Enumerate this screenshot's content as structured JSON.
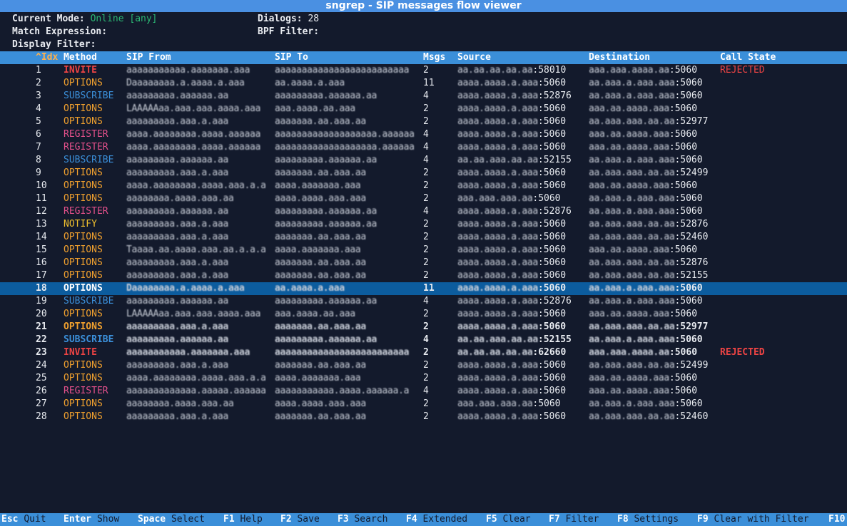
{
  "title": "sngrep - SIP messages flow viewer",
  "info": {
    "mode_label": "Current Mode:",
    "mode_value": "Online [any]",
    "dialogs_label": "Dialogs:",
    "dialogs_value": "28",
    "match_label": "Match Expression:",
    "bpf_label": "BPF Filter:",
    "display_label": "Display Filter:"
  },
  "columns": [
    "^Idx",
    "Method",
    "SIP From",
    "SIP To",
    "Msgs",
    "Source",
    "Destination",
    "Call State"
  ],
  "rows": [
    {
      "check": "[ ]",
      "idx": "1",
      "method": "INVITE",
      "from": "aaaaaaaaaaa.aaaaaaa.aaa",
      "to": "aaaaaaaaaaaaaaaaaaaaaaaaa",
      "msgs": "2",
      "src_ip": "aa.aa.aa.aa.aa",
      "src_port": ":58010",
      "dst_ip": "aaa.aaa.aaaa.aa",
      "dst_port": ":5060",
      "state": "REJECTED"
    },
    {
      "check": "[ ]",
      "idx": "2",
      "method": "OPTIONS",
      "from": "Daaaaaaaa.a.aaaa.a.aaa",
      "to": "aa.aaaa.a.aaa",
      "msgs": "11",
      "src_ip": "aaaa.aaaa.a.aaa",
      "src_port": ":5060",
      "dst_ip": "aa.aaa.a.aaa.aaa",
      "dst_port": ":5060",
      "state": ""
    },
    {
      "check": "[ ]",
      "idx": "3",
      "method": "SUBSCRIBE",
      "from": "aaaaaaaaa.aaaaaa.aa",
      "to": "aaaaaaaaa.aaaaaa.aa",
      "msgs": "4",
      "src_ip": "aaaa.aaaa.a.aaa",
      "src_port": ":52876",
      "dst_ip": "aa.aaa.a.aaa.aaa",
      "dst_port": ":5060",
      "state": ""
    },
    {
      "check": "[ ]",
      "idx": "4",
      "method": "OPTIONS",
      "from": "LAAAAAaa.aaa.aaa.aaaa.aaa",
      "to": "aaa.aaaa.aa.aaa",
      "msgs": "2",
      "src_ip": "aaaa.aaaa.a.aaa",
      "src_port": ":5060",
      "dst_ip": "aaa.aa.aaaa.aaa",
      "dst_port": ":5060",
      "state": ""
    },
    {
      "check": "[ ]",
      "idx": "5",
      "method": "OPTIONS",
      "from": "aaaaaaaaa.aaa.a.aaa",
      "to": "aaaaaaa.aa.aaa.aa",
      "msgs": "2",
      "src_ip": "aaaa.aaaa.a.aaa",
      "src_port": ":5060",
      "dst_ip": "aa.aaa.aaa.aa.aa",
      "dst_port": ":52977",
      "state": ""
    },
    {
      "check": "[ ]",
      "idx": "6",
      "method": "REGISTER",
      "from": "aaaa.aaaaaaaa.aaaa.aaaaaa",
      "to": "aaaaaaaaaaaaaaaaaaa.aaaaaa",
      "msgs": "4",
      "src_ip": "aaaa.aaaa.a.aaa",
      "src_port": ":5060",
      "dst_ip": "aaa.aa.aaaa.aaa",
      "dst_port": ":5060",
      "state": ""
    },
    {
      "check": "[ ]",
      "idx": "7",
      "method": "REGISTER",
      "from": "aaaa.aaaaaaaa.aaaa.aaaaaa",
      "to": "aaaaaaaaaaaaaaaaaaa.aaaaaa",
      "msgs": "4",
      "src_ip": "aaaa.aaaa.a.aaa",
      "src_port": ":5060",
      "dst_ip": "aaa.aa.aaaa.aaa",
      "dst_port": ":5060",
      "state": ""
    },
    {
      "check": "[ ]",
      "idx": "8",
      "method": "SUBSCRIBE",
      "from": "aaaaaaaaa.aaaaaa.aa",
      "to": "aaaaaaaaa.aaaaaa.aa",
      "msgs": "4",
      "src_ip": "aa.aa.aaa.aa.aa",
      "src_port": ":52155",
      "dst_ip": "aa.aaa.a.aaa.aaa",
      "dst_port": ":5060",
      "state": ""
    },
    {
      "check": "[ ]",
      "idx": "9",
      "method": "OPTIONS",
      "from": "aaaaaaaaa.aaa.a.aaa",
      "to": "aaaaaaa.aa.aaa.aa",
      "msgs": "2",
      "src_ip": "aaaa.aaaa.a.aaa",
      "src_port": ":5060",
      "dst_ip": "aa.aaa.aaa.aa.aa",
      "dst_port": ":52499",
      "state": ""
    },
    {
      "check": "[ ]",
      "idx": "10",
      "method": "OPTIONS",
      "from": "aaaa.aaaaaaaa.aaaa.aaa.a.a",
      "to": "aaaa.aaaaaaa.aaa",
      "msgs": "2",
      "src_ip": "aaaa.aaaa.a.aaa",
      "src_port": ":5060",
      "dst_ip": "aaa.aa.aaaa.aaa",
      "dst_port": ":5060",
      "state": ""
    },
    {
      "check": "[ ]",
      "idx": "11",
      "method": "OPTIONS",
      "from": "aaaaaaaa.aaaa.aaa.aa",
      "to": "aaaa.aaaa.aaa.aaa",
      "msgs": "2",
      "src_ip": "aaa.aaa.aaa.aa",
      "src_port": ":5060",
      "dst_ip": "aa.aaa.a.aaa.aaa",
      "dst_port": ":5060",
      "state": ""
    },
    {
      "check": "[ ]",
      "idx": "12",
      "method": "REGISTER",
      "from": "aaaaaaaaa.aaaaaa.aa",
      "to": "aaaaaaaaa.aaaaaa.aa",
      "msgs": "4",
      "src_ip": "aaaa.aaaa.a.aaa",
      "src_port": ":52876",
      "dst_ip": "aa.aaa.a.aaa.aaa",
      "dst_port": ":5060",
      "state": ""
    },
    {
      "check": "[ ]",
      "idx": "13",
      "method": "NOTIFY",
      "from": "aaaaaaaaa.aaa.a.aaa",
      "to": "aaaaaaaaa.aaaaaa.aa",
      "msgs": "2",
      "src_ip": "aaaa.aaaa.a.aaa",
      "src_port": ":5060",
      "dst_ip": "aa.aaa.aaa.aa.aa",
      "dst_port": ":52876",
      "state": ""
    },
    {
      "check": "[ ]",
      "idx": "14",
      "method": "OPTIONS",
      "from": "aaaaaaaaa.aaa.a.aaa",
      "to": "aaaaaaa.aa.aaa.aa",
      "msgs": "2",
      "src_ip": "aaaa.aaaa.a.aaa",
      "src_port": ":5060",
      "dst_ip": "aa.aaa.aaa.aa.aa",
      "dst_port": ":52460",
      "state": ""
    },
    {
      "check": "[ ]",
      "idx": "15",
      "method": "OPTIONS",
      "from": "Taaaa.aa.aaaa.aaa.aa.a.a.a",
      "to": "aaaa.aaaaaaa.aaa",
      "msgs": "2",
      "src_ip": "aaaa.aaaa.a.aaa",
      "src_port": ":5060",
      "dst_ip": "aaa.aa.aaaa.aaa",
      "dst_port": ":5060",
      "state": ""
    },
    {
      "check": "[ ]",
      "idx": "16",
      "method": "OPTIONS",
      "from": "aaaaaaaaa.aaa.a.aaa",
      "to": "aaaaaaa.aa.aaa.aa",
      "msgs": "2",
      "src_ip": "aaaa.aaaa.a.aaa",
      "src_port": ":5060",
      "dst_ip": "aa.aaa.aaa.aa.aa",
      "dst_port": ":52876",
      "state": ""
    },
    {
      "check": "[ ]",
      "idx": "17",
      "method": "OPTIONS",
      "from": "aaaaaaaaa.aaa.a.aaa",
      "to": "aaaaaaa.aa.aaa.aa",
      "msgs": "2",
      "src_ip": "aaaa.aaaa.a.aaa",
      "src_port": ":5060",
      "dst_ip": "aa.aaa.aaa.aa.aa",
      "dst_port": ":52155",
      "state": ""
    },
    {
      "check": "[*]",
      "idx": "18",
      "method": "OPTIONS",
      "from": "Daaaaaaaa.a.aaaa.a.aaa",
      "to": "aa.aaaa.a.aaa",
      "msgs": "11",
      "src_ip": "aaaa.aaaa.a.aaa",
      "src_port": ":5060",
      "dst_ip": "aa.aaa.a.aaa.aaa",
      "dst_port": ":5060",
      "state": "",
      "highlight": true
    },
    {
      "check": "[ ]",
      "idx": "19",
      "method": "SUBSCRIBE",
      "from": "aaaaaaaaa.aaaaaa.aa",
      "to": "aaaaaaaaa.aaaaaa.aa",
      "msgs": "4",
      "src_ip": "aaaa.aaaa.a.aaa",
      "src_port": ":52876",
      "dst_ip": "aa.aaa.a.aaa.aaa",
      "dst_port": ":5060",
      "state": ""
    },
    {
      "check": "[ ]",
      "idx": "20",
      "method": "OPTIONS",
      "from": "LAAAAAaa.aaa.aaa.aaaa.aaa",
      "to": "aaa.aaaa.aa.aaa",
      "msgs": "2",
      "src_ip": "aaaa.aaaa.a.aaa",
      "src_port": ":5060",
      "dst_ip": "aaa.aa.aaaa.aaa",
      "dst_port": ":5060",
      "state": ""
    },
    {
      "check": "[*]",
      "idx": "21",
      "method": "OPTIONS",
      "from": "aaaaaaaaa.aaa.a.aaa",
      "to": "aaaaaaa.aa.aaa.aa",
      "msgs": "2",
      "src_ip": "aaaa.aaaa.a.aaa",
      "src_port": ":5060",
      "dst_ip": "aa.aaa.aaa.aa.aa",
      "dst_port": ":52977",
      "state": "",
      "selected": true
    },
    {
      "check": "[*]",
      "idx": "22",
      "method": "SUBSCRIBE",
      "from": "aaaaaaaaa.aaaaaa.aa",
      "to": "aaaaaaaaa.aaaaaa.aa",
      "msgs": "4",
      "src_ip": "aa.aa.aaa.aa.aa",
      "src_port": ":52155",
      "dst_ip": "aa.aaa.a.aaa.aaa",
      "dst_port": ":5060",
      "state": "",
      "selected": true
    },
    {
      "check": "[*]",
      "idx": "23",
      "method": "INVITE",
      "from": "aaaaaaaaaaa.aaaaaaa.aaa",
      "to": "aaaaaaaaaaaaaaaaaaaaaaaaa",
      "msgs": "2",
      "src_ip": "aa.aa.aa.aa.aa",
      "src_port": ":62660",
      "dst_ip": "aaa.aaa.aaaa.aa",
      "dst_port": ":5060",
      "state": "REJECTED",
      "selected": true
    },
    {
      "check": "[ ]",
      "idx": "24",
      "method": "OPTIONS",
      "from": "aaaaaaaaa.aaa.a.aaa",
      "to": "aaaaaaa.aa.aaa.aa",
      "msgs": "2",
      "src_ip": "aaaa.aaaa.a.aaa",
      "src_port": ":5060",
      "dst_ip": "aa.aaa.aaa.aa.aa",
      "dst_port": ":52499",
      "state": ""
    },
    {
      "check": "[ ]",
      "idx": "25",
      "method": "OPTIONS",
      "from": "aaaa.aaaaaaaa.aaaa.aaa.a.a",
      "to": "aaaa.aaaaaaa.aaa",
      "msgs": "2",
      "src_ip": "aaaa.aaaa.a.aaa",
      "src_port": ":5060",
      "dst_ip": "aaa.aa.aaaa.aaa",
      "dst_port": ":5060",
      "state": ""
    },
    {
      "check": "[ ]",
      "idx": "26",
      "method": "REGISTER",
      "from": "aaaaaaaaaaaaa.aaaaa.aaaaaa",
      "to": "aaaaaaaaaaa.aaaa.aaaaaa.a",
      "msgs": "4",
      "src_ip": "aaaa.aaaa.a.aaa",
      "src_port": ":5060",
      "dst_ip": "aaa.aa.aaaa.aaa",
      "dst_port": ":5060",
      "state": ""
    },
    {
      "check": "[ ]",
      "idx": "27",
      "method": "OPTIONS",
      "from": "aaaaaaaa.aaaa.aaa.aa",
      "to": "aaaa.aaaa.aaa.aaa",
      "msgs": "2",
      "src_ip": "aaa.aaa.aaa.aa",
      "src_port": ":5060",
      "dst_ip": "aa.aaa.a.aaa.aaa",
      "dst_port": ":5060",
      "state": ""
    },
    {
      "check": "[ ]",
      "idx": "28",
      "method": "OPTIONS",
      "from": "aaaaaaaaa.aaa.a.aaa",
      "to": "aaaaaaa.aa.aaa.aa",
      "msgs": "2",
      "src_ip": "aaaa.aaaa.a.aaa",
      "src_port": ":5060",
      "dst_ip": "aa.aaa.aaa.aa.aa",
      "dst_port": ":52460",
      "state": ""
    }
  ],
  "footer": [
    {
      "key": "Esc",
      "action": "Quit"
    },
    {
      "key": "Enter",
      "action": "Show"
    },
    {
      "key": "Space",
      "action": "Select"
    },
    {
      "key": "F1",
      "action": "Help"
    },
    {
      "key": "F2",
      "action": "Save"
    },
    {
      "key": "F3",
      "action": "Search"
    },
    {
      "key": "F4",
      "action": "Extended"
    },
    {
      "key": "F5",
      "action": "Clear"
    },
    {
      "key": "F7",
      "action": "Filter"
    },
    {
      "key": "F8",
      "action": "Settings"
    },
    {
      "key": "F9",
      "action": "Clear with Filter"
    },
    {
      "key": "F10",
      "action": ""
    }
  ],
  "colors": {
    "background": "#131a2c",
    "header_bar": "#4a90e2",
    "column_bar": "#3b8fd9",
    "highlight_row": "#0c5c9e",
    "invite": "#ee4444",
    "options": "#f0a02e",
    "subscribe": "#3b8fd9",
    "register": "#e2508a",
    "notify": "#f0c02e",
    "online": "#2bb673"
  }
}
